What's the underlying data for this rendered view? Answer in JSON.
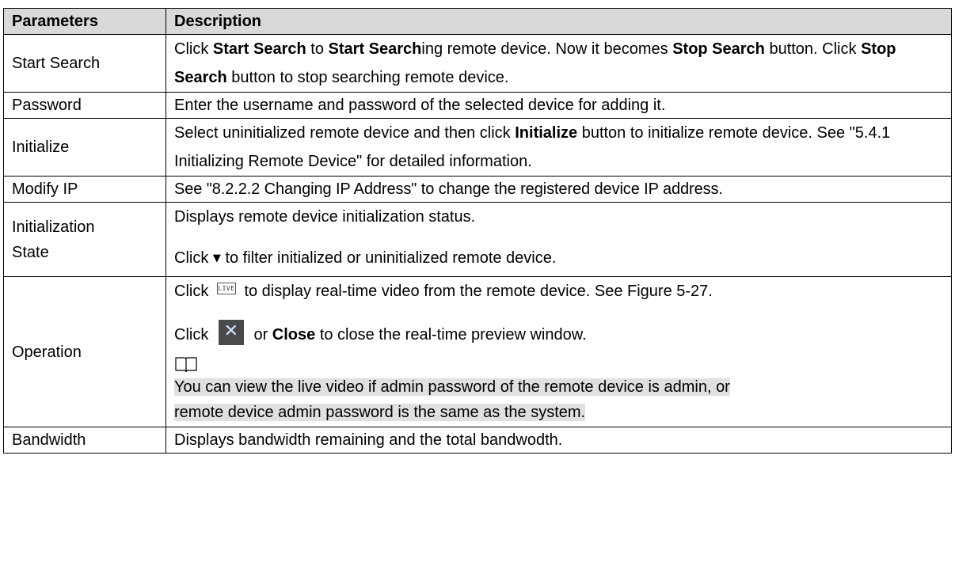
{
  "table": {
    "headers": [
      "Parameters",
      "Description"
    ],
    "rows": {
      "start_search": {
        "param": "Start Search",
        "t1": "Click ",
        "b1": "Start Search",
        "t2": " to ",
        "b2": "Start Search",
        "t3": "ing remote device. Now it becomes ",
        "b3": "Stop Search",
        "t4": " button. Click ",
        "b4": "Stop Search",
        "t5": " button to stop searching remote device."
      },
      "password": {
        "param": "Password",
        "desc": "Enter the username and password of the selected device for adding it."
      },
      "initialize": {
        "param": "Initialize",
        "t1": "Select uninitialized remote device and then click ",
        "b1": "Initialize",
        "t2": " button to initialize remote device. See \"5.4.1 Initializing Remote Device\" for detailed information."
      },
      "modify_ip": {
        "param": "Modify IP",
        "desc": "See \"8.2.2.2 Changing IP Address\" to change the registered device IP address."
      },
      "init_state": {
        "param_line1": "Initialization",
        "param_line2": "State",
        "line1": "Displays remote device initialization status.",
        "line2_a": "Click ",
        "line2_b": " to filter initialized or uninitialized remote device."
      },
      "operation": {
        "param": "Operation",
        "live_icon_text": "LIVE",
        "line1_a": "Click ",
        "line1_b": " to display real-time video from the remote device. See Figure 5-27.",
        "line2_a": "Click ",
        "line2_b": " or ",
        "line2_bold": "Close",
        "line2_c": " to close the real-time preview window.",
        "note_line1": "You can view the live video if admin password of the remote device is admin, or",
        "note_line2": "remote device admin password is the same as the system."
      },
      "bandwidth": {
        "param": "Bandwidth",
        "desc": "Displays bandwidth remaining and the total bandwodth."
      }
    }
  },
  "icons": {
    "caret": "dropdown-caret-icon",
    "live": "live-icon",
    "close": "close-icon",
    "note": "book-note-icon"
  }
}
